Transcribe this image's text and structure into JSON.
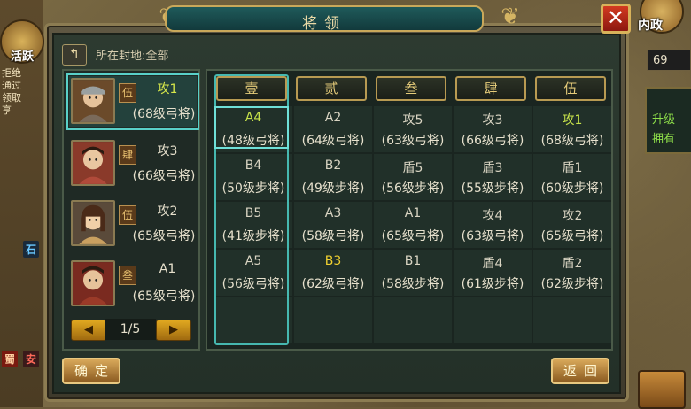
{
  "background": {
    "huoyue_label": "活跃",
    "neizheng_label": "内政",
    "resource_value": "69",
    "right_panel_line1": "升级",
    "right_panel_line2": "拥有",
    "left_strip_lines": [
      "拒绝",
      "通过",
      "领取",
      "享"
    ],
    "badge_shi": "石",
    "badge_an": "安",
    "badge_shu": "蜀"
  },
  "dialog": {
    "title": "将领",
    "close_label": "✕",
    "fief_label": "所在封地:全部",
    "back_arrow": "↰",
    "confirm_label": "确定",
    "return_label": "返回"
  },
  "generals": [
    {
      "rank": "伍",
      "code": "攻1",
      "level": "(68级弓将)",
      "selected": true
    },
    {
      "rank": "肆",
      "code": "攻3",
      "level": "(66级弓将)",
      "selected": false
    },
    {
      "rank": "伍",
      "code": "攻2",
      "level": "(65级弓将)",
      "selected": false
    },
    {
      "rank": "叁",
      "code": "A1",
      "level": "(65级弓将)",
      "selected": false
    }
  ],
  "pager": {
    "prev": "◀",
    "page_text": "1/5",
    "next": "▶"
  },
  "formation": {
    "columns": [
      "壹",
      "贰",
      "叁",
      "肆",
      "伍"
    ],
    "rows": [
      [
        {
          "code": "A4",
          "level": "(48级弓将)",
          "color": "green"
        },
        {
          "code": "A2",
          "level": "(64级弓将)",
          "color": "normal"
        },
        {
          "code": "攻5",
          "level": "(63级弓将)",
          "color": "normal"
        },
        {
          "code": "攻3",
          "level": "(66级弓将)",
          "color": "normal"
        },
        {
          "code": "攻1",
          "level": "(68级弓将)",
          "color": "green"
        }
      ],
      [
        {
          "code": "B4",
          "level": "(50级步将)",
          "color": "normal"
        },
        {
          "code": "B2",
          "level": "(49级步将)",
          "color": "normal"
        },
        {
          "code": "盾5",
          "level": "(56级步将)",
          "color": "normal"
        },
        {
          "code": "盾3",
          "level": "(55级步将)",
          "color": "normal"
        },
        {
          "code": "盾1",
          "level": "(60级步将)",
          "color": "normal"
        }
      ],
      [
        {
          "code": "B5",
          "level": "(41级步将)",
          "color": "normal"
        },
        {
          "code": "A3",
          "level": "(58级弓将)",
          "color": "normal"
        },
        {
          "code": "A1",
          "level": "(65级弓将)",
          "color": "normal"
        },
        {
          "code": "攻4",
          "level": "(63级弓将)",
          "color": "normal"
        },
        {
          "code": "攻2",
          "level": "(65级弓将)",
          "color": "normal"
        }
      ],
      [
        {
          "code": "A5",
          "level": "(56级弓将)",
          "color": "normal"
        },
        {
          "code": "B3",
          "level": "(62级弓将)",
          "color": "yellow"
        },
        {
          "code": "B1",
          "level": "(58级步将)",
          "color": "normal"
        },
        {
          "code": "盾4",
          "level": "(61级步将)",
          "color": "normal"
        },
        {
          "code": "盾2",
          "level": "(62级步将)",
          "color": "normal"
        }
      ]
    ]
  },
  "colors": {
    "highlight": "#46b8b0",
    "green_text": "#c6e14a",
    "yellow_text": "#f0d030"
  }
}
